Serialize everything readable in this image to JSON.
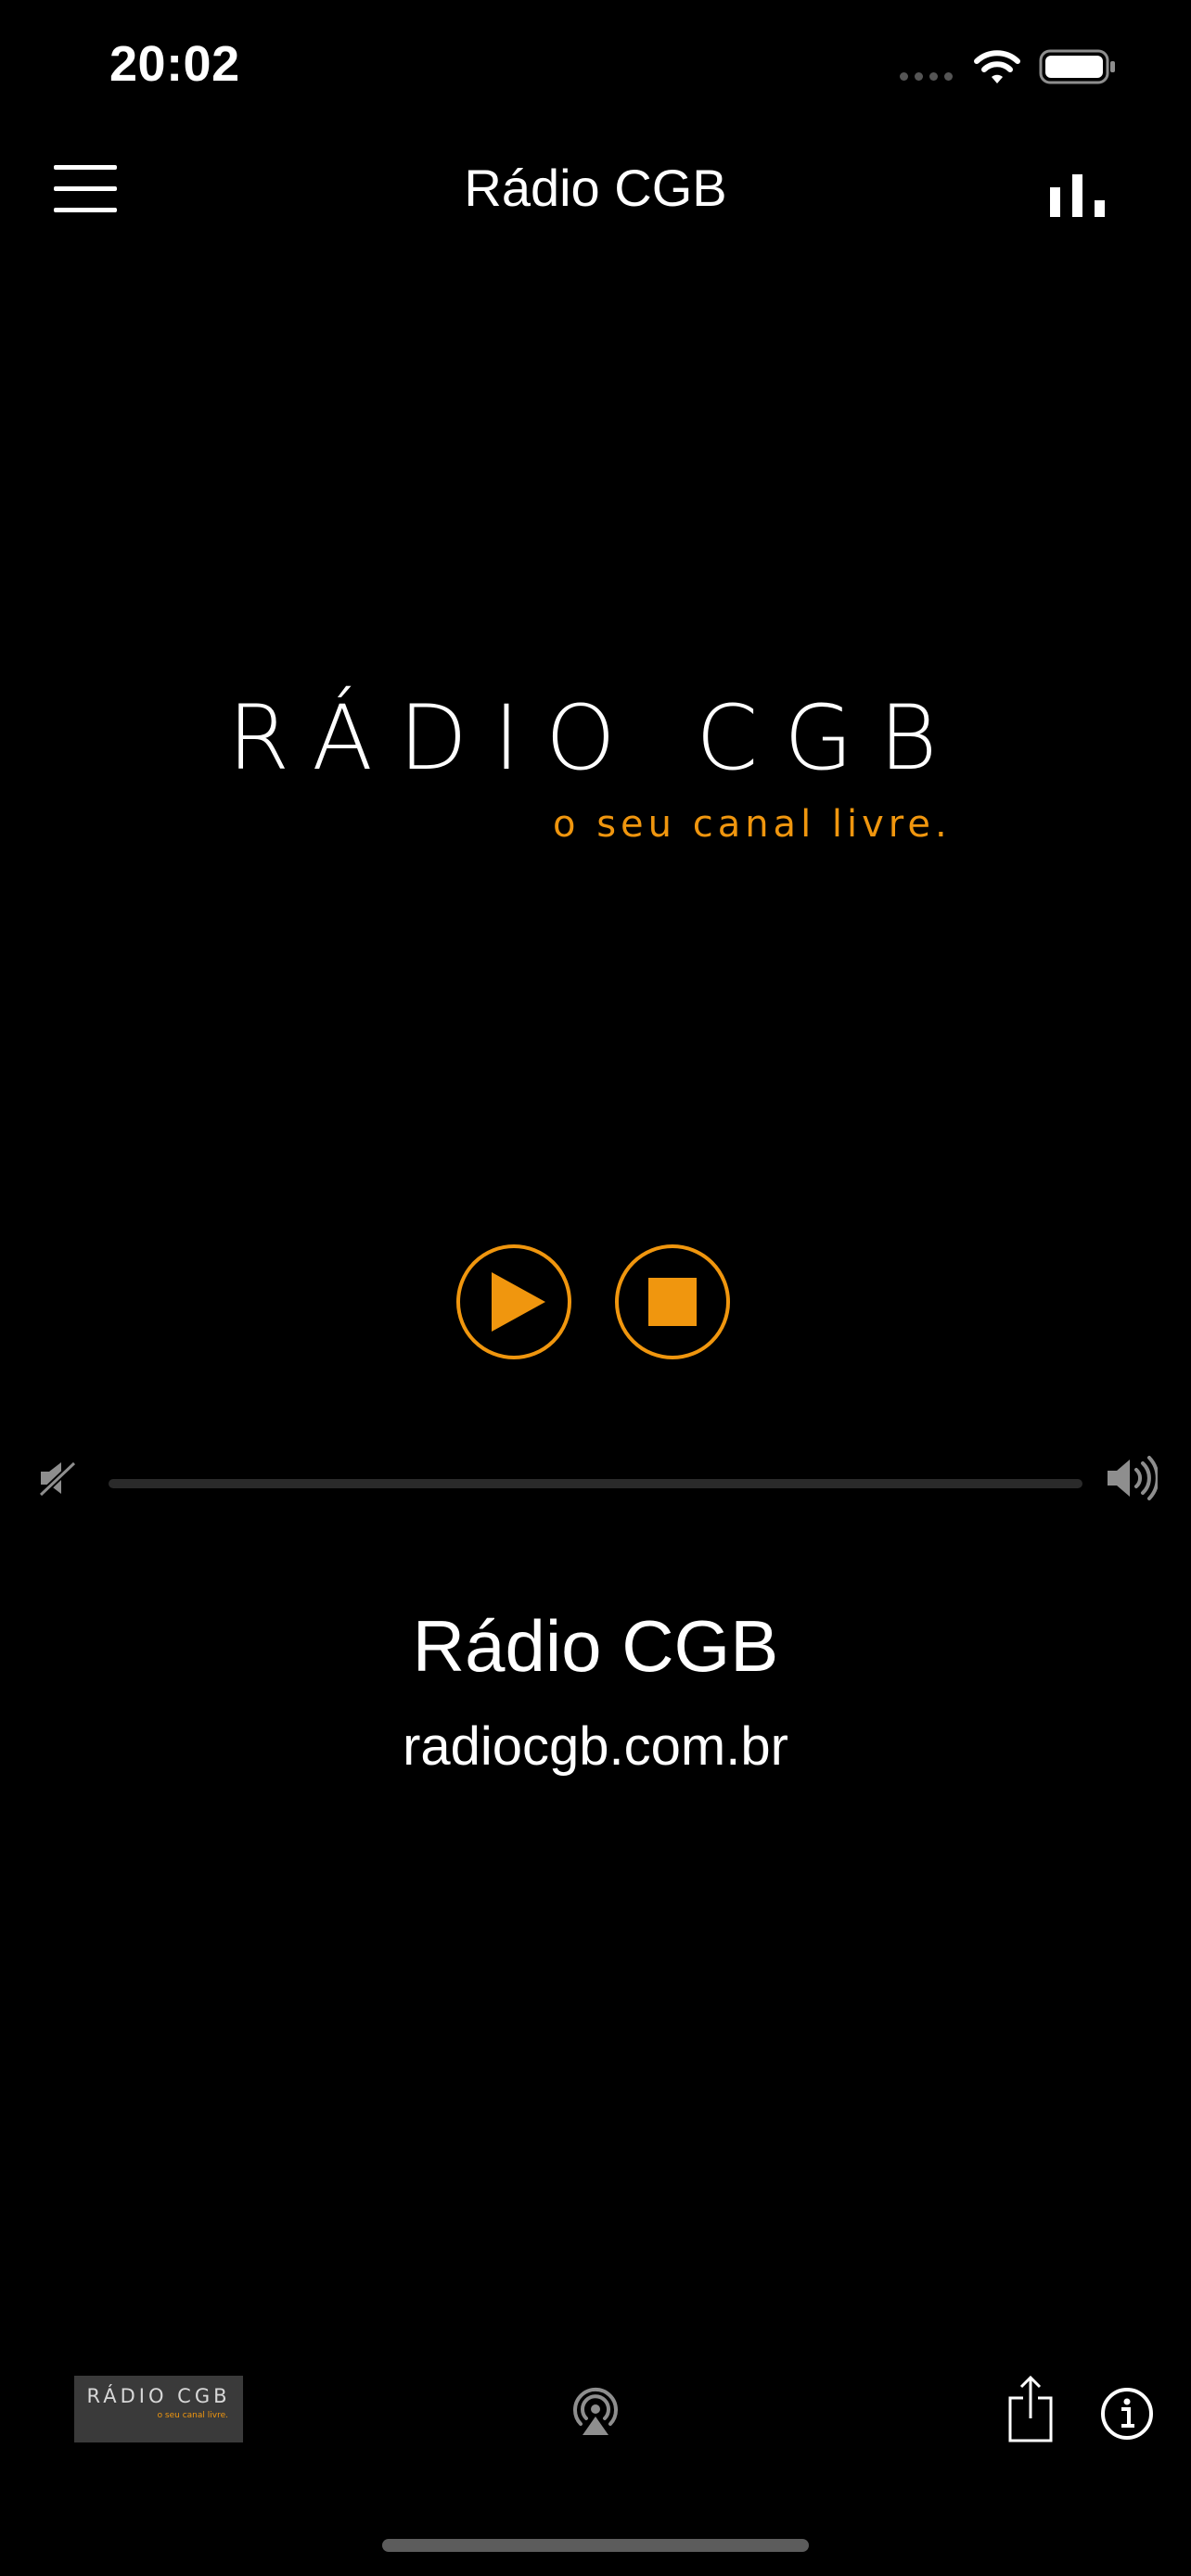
{
  "status_bar": {
    "time": "20:02",
    "icons": [
      "signal-icon",
      "wifi-icon",
      "battery-icon"
    ]
  },
  "nav": {
    "title": "Rádio CGB",
    "left_icon": "hamburger-menu-icon",
    "right_icon": "bar-chart-icon"
  },
  "logo": {
    "main": "RÁDIO CGB",
    "tagline": "o seu canal livre."
  },
  "controls": {
    "play_icon": "play-icon",
    "stop_icon": "stop-icon"
  },
  "volume": {
    "min_icon": "volume-mute-icon",
    "max_icon": "volume-up-icon",
    "level": 0
  },
  "station": {
    "name": "Rádio CGB",
    "url": "radiocgb.com.br"
  },
  "bottom_bar": {
    "thumb_main": "RÁDIO CGB",
    "thumb_tagline": "o seu canal livre.",
    "airplay_icon": "airplay-icon",
    "share_icon": "share-icon",
    "info_icon": "info-icon"
  },
  "colors": {
    "background": "#000000",
    "accent": "#f0960e",
    "text": "#ffffff"
  }
}
